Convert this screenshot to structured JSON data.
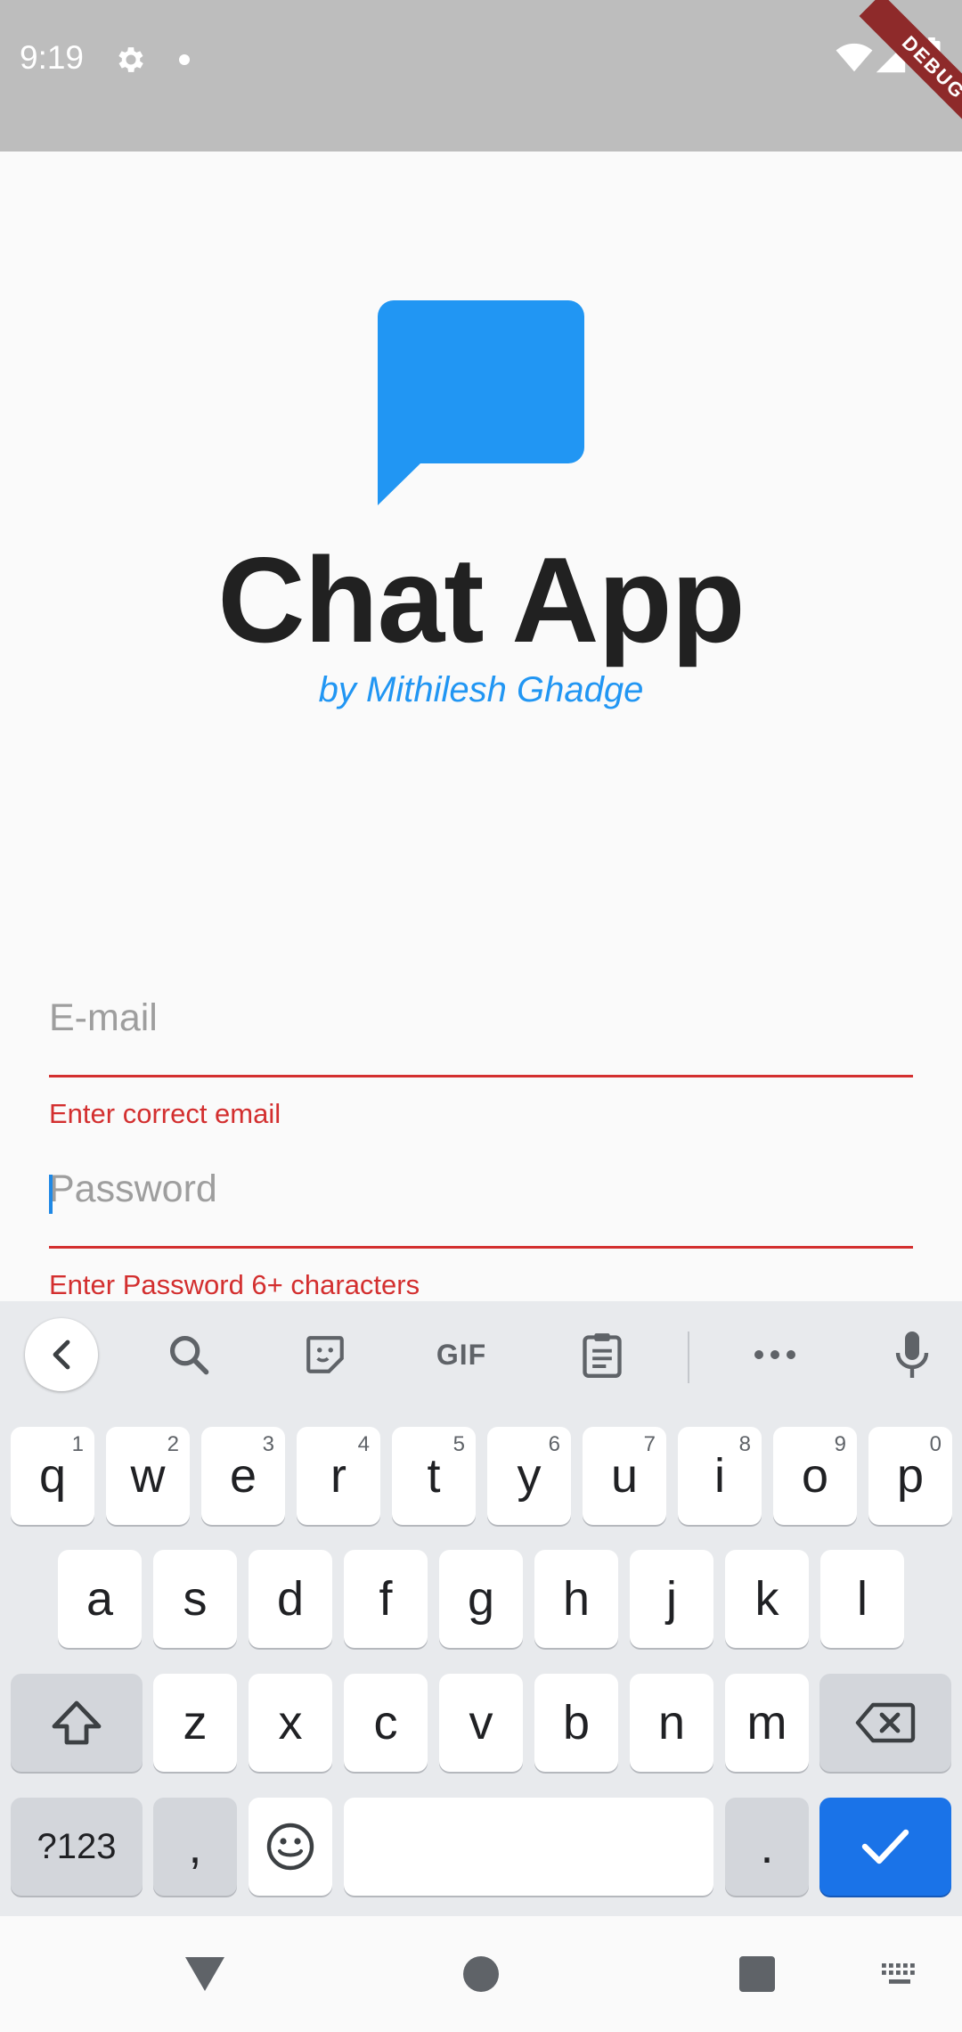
{
  "status_bar": {
    "time": "9:19",
    "debug_label": "DEBUG"
  },
  "app": {
    "title": "Chat App",
    "subtitle": "by Mithilesh Ghadge",
    "logo_icon": "chat-bubble-icon",
    "accent_color": "#2196f3"
  },
  "form": {
    "email": {
      "placeholder": "E-mail",
      "value": "",
      "error": "Enter correct email"
    },
    "password": {
      "placeholder": "Password",
      "value": "",
      "error": "Enter Password 6+ characters"
    },
    "error_color": "#d32f2f"
  },
  "keyboard": {
    "toolbar": {
      "gif_label": "GIF"
    },
    "row1": [
      {
        "label": "q",
        "hint": "1"
      },
      {
        "label": "w",
        "hint": "2"
      },
      {
        "label": "e",
        "hint": "3"
      },
      {
        "label": "r",
        "hint": "4"
      },
      {
        "label": "t",
        "hint": "5"
      },
      {
        "label": "y",
        "hint": "6"
      },
      {
        "label": "u",
        "hint": "7"
      },
      {
        "label": "i",
        "hint": "8"
      },
      {
        "label": "o",
        "hint": "9"
      },
      {
        "label": "p",
        "hint": "0"
      }
    ],
    "row2": [
      "a",
      "s",
      "d",
      "f",
      "g",
      "h",
      "j",
      "k",
      "l"
    ],
    "row3": [
      "z",
      "x",
      "c",
      "v",
      "b",
      "n",
      "m"
    ],
    "symbols_label": "?123",
    "comma_label": ",",
    "period_label": ".",
    "action_color": "#1a73e8"
  }
}
